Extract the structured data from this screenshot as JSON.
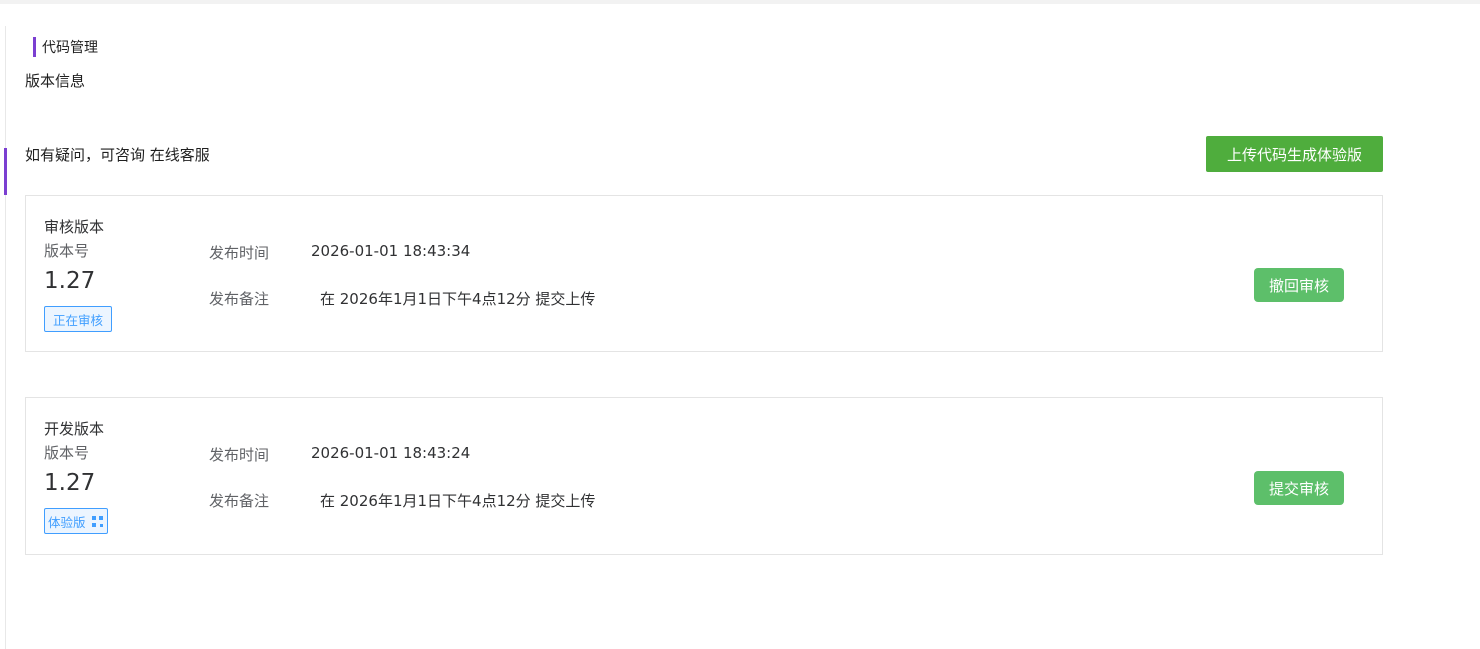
{
  "header": {
    "section_title": "代码管理",
    "subtitle": "版本信息",
    "help_prefix": "如有疑问，可咨询",
    "help_link": "在线客服",
    "upload_button": "上传代码生成体验版"
  },
  "labels": {
    "version_number": "版本号",
    "publish_time": "发布时间",
    "publish_note": "发布备注"
  },
  "review_version": {
    "kind": "审核版本",
    "version": "1.27",
    "status_tag": "正在审核",
    "publish_time": "2026-01-01 18:43:34",
    "publish_note": "在 2026年1月1日下午4点12分 提交上传",
    "action_button": "撤回审核"
  },
  "dev_version": {
    "kind": "开发版本",
    "version": "1.27",
    "status_tag": "体验版",
    "status_icon": "qrcode-icon",
    "publish_time": "2026-01-01 18:43:24",
    "publish_note": "在 2026年1月1日下午4点12分 提交上传",
    "action_button": "提交审核"
  },
  "colors": {
    "accent_purple": "#7b3fd1",
    "primary_green": "#4fad3d",
    "action_green": "#5dbf6a",
    "tag_blue": "#409eff"
  }
}
